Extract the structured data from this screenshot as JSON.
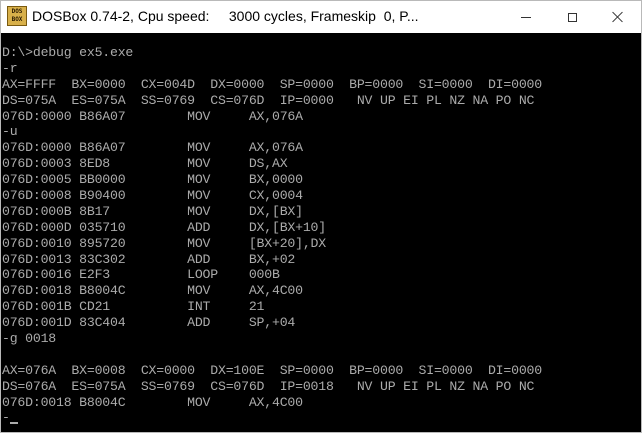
{
  "window": {
    "title": "DOSBox 0.74-2, Cpu speed:     3000 cycles, Frameskip  0, P...",
    "icon": "dosbox-icon",
    "icon_text": "DOS BOX"
  },
  "terminal": {
    "lines": [
      "D:\\>debug ex5.exe",
      "-r",
      "AX=FFFF  BX=0000  CX=004D  DX=0000  SP=0000  BP=0000  SI=0000  DI=0000",
      "DS=075A  ES=075A  SS=0769  CS=076D  IP=0000   NV UP EI PL NZ NA PO NC",
      "076D:0000 B86A07        MOV     AX,076A",
      "-u",
      "076D:0000 B86A07        MOV     AX,076A",
      "076D:0003 8ED8          MOV     DS,AX",
      "076D:0005 BB0000        MOV     BX,0000",
      "076D:0008 B90400        MOV     CX,0004",
      "076D:000B 8B17          MOV     DX,[BX]",
      "076D:000D 035710        ADD     DX,[BX+10]",
      "076D:0010 895720        MOV     [BX+20],DX",
      "076D:0013 83C302        ADD     BX,+02",
      "076D:0016 E2F3          LOOP    000B",
      "076D:0018 B8004C        MOV     AX,4C00",
      "076D:001B CD21          INT     21",
      "076D:001D 83C404        ADD     SP,+04",
      "-g 0018",
      "",
      "AX=076A  BX=0008  CX=0000  DX=100E  SP=0000  BP=0000  SI=0000  DI=0000",
      "DS=076A  ES=075A  SS=0769  CS=076D  IP=0018   NV UP EI PL NZ NA PO NC",
      "076D:0018 B8004C        MOV     AX,4C00"
    ],
    "prompt": "-",
    "colors": {
      "background": "#000000",
      "text": "#ababab"
    }
  }
}
